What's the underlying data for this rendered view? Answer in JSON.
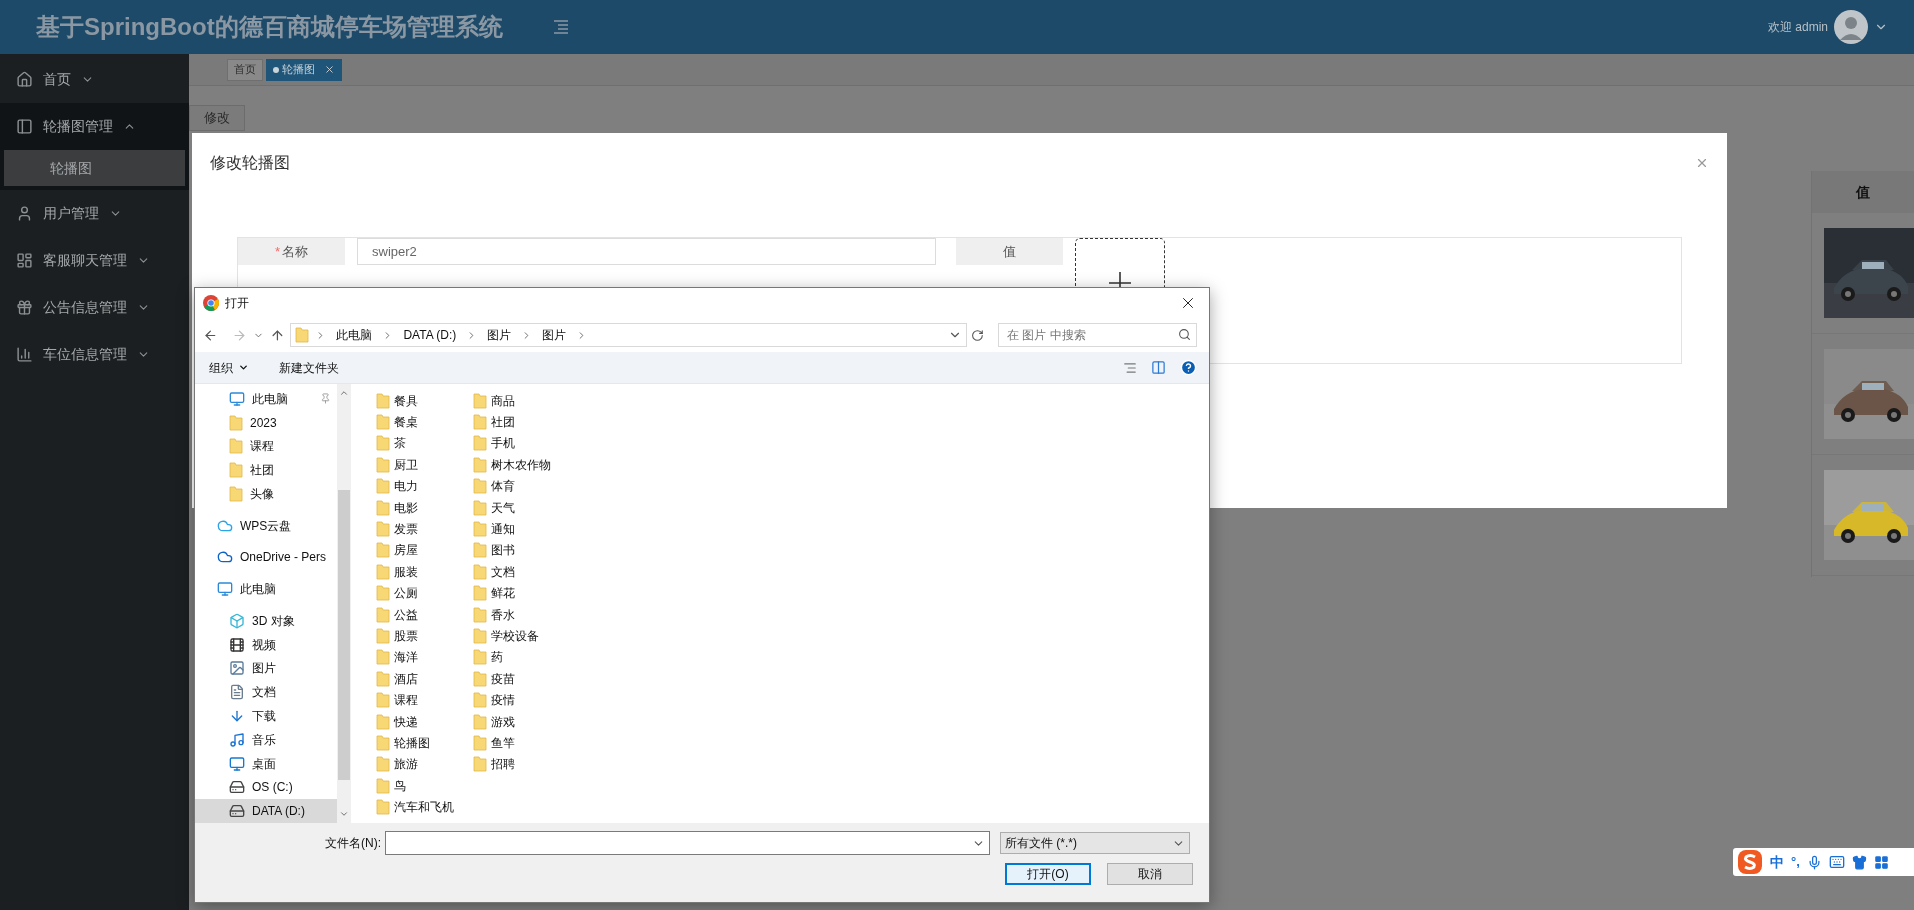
{
  "header": {
    "title": "基于SpringBoot的德百商城停车场管理系统",
    "greeting": "欢迎 admin"
  },
  "sidebar": {
    "items": [
      {
        "label": "首页",
        "expanded": false
      },
      {
        "label": "轮播图管理",
        "expanded": true,
        "children": [
          {
            "label": "轮播图",
            "selected": true
          }
        ]
      },
      {
        "label": "用户管理",
        "expanded": false
      },
      {
        "label": "客服聊天管理",
        "expanded": false
      },
      {
        "label": "公告信息管理",
        "expanded": false
      },
      {
        "label": "车位信息管理",
        "expanded": false
      }
    ]
  },
  "tabs": [
    {
      "label": "首页",
      "selected": false,
      "closable": false
    },
    {
      "label": "轮播图",
      "selected": true,
      "closable": true
    }
  ],
  "action_tabs": [
    {
      "label": "修改"
    }
  ],
  "table": {
    "columns": [
      "值"
    ],
    "rows": [
      {
        "value": {
          "kind": "picture"
        }
      },
      {
        "value": {
          "kind": "picture"
        }
      },
      {
        "value": {
          "kind": "picture"
        }
      }
    ]
  },
  "modal": {
    "title": "修改轮播图",
    "fields": [
      {
        "kind": "text",
        "marker": "*",
        "label": "名称",
        "value": "swiper2"
      },
      {
        "kind": "upload",
        "label": "值"
      }
    ]
  },
  "file_dialog": {
    "title": "打开",
    "breadcrumb": [
      "此电脑",
      "DATA (D:)",
      "图片",
      "图片"
    ],
    "search_placeholder": "在 图片 中搜索",
    "toolbar": [
      "组织",
      "新建文件夹"
    ],
    "quick_access": [
      {
        "kind": "pc",
        "label": "此电脑",
        "pinned": true
      },
      {
        "kind": "folder",
        "label": "2023",
        "pinned": false
      },
      {
        "kind": "folder",
        "label": "课程",
        "pinned": false
      },
      {
        "kind": "folder",
        "label": "社团",
        "pinned": false
      },
      {
        "kind": "folder",
        "label": "头像",
        "pinned": false
      }
    ],
    "nav_tree": [
      {
        "kind": "cloud",
        "label": "WPS云盘",
        "selected": false
      },
      {
        "kind": "onedrive",
        "label": "OneDrive - Pers",
        "selected": false
      },
      {
        "kind": "pc",
        "label": "此电脑",
        "selected": false,
        "children": [
          {
            "kind": "cube",
            "label": "3D 对象",
            "selected": false
          },
          {
            "kind": "video",
            "label": "视频",
            "selected": false
          },
          {
            "kind": "picture",
            "label": "图片",
            "selected": false
          },
          {
            "kind": "document",
            "label": "文档",
            "selected": false
          },
          {
            "kind": "download",
            "label": "下载",
            "selected": false
          },
          {
            "kind": "music",
            "label": "音乐",
            "selected": false
          },
          {
            "kind": "desktop",
            "label": "桌面",
            "selected": false
          },
          {
            "kind": "system_drive",
            "label": "OS (C:)",
            "selected": false
          },
          {
            "kind": "drive",
            "label": "DATA (D:)",
            "selected": true
          }
        ]
      }
    ],
    "folders": [
      "餐具",
      "餐桌",
      "茶",
      "厨卫",
      "电力",
      "电影",
      "发票",
      "房屋",
      "服装",
      "公厕",
      "公益",
      "股票",
      "海洋",
      "酒店",
      "课程",
      "快递",
      "轮播图",
      "旅游",
      "鸟",
      "汽车和飞机",
      "商品",
      "社团",
      "手机",
      "树木农作物",
      "体育",
      "天气",
      "通知",
      "图书",
      "文档",
      "鲜花",
      "香水",
      "学校设备",
      "药",
      "疫苗",
      "疫情",
      "游戏",
      "鱼竿",
      "招聘"
    ],
    "filename_label": "文件名(N):",
    "filter": "所有文件 (*.*)",
    "buttons": [
      {
        "label": "打开(O)",
        "default": true
      },
      {
        "label": "取消",
        "default": false
      }
    ]
  },
  "ime": {
    "mode": "中",
    "punctuation": "°,"
  }
}
